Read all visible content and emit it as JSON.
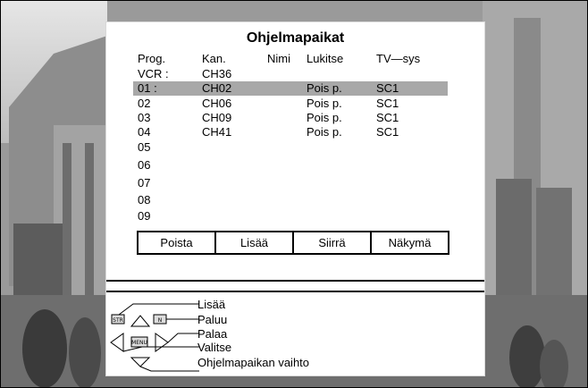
{
  "menu": {
    "title": "Ohjelmapaikat",
    "headers": {
      "prog": "Prog.",
      "kan": "Kan.",
      "nimi": "Nimi",
      "lukitse": "Lukitse",
      "tvsys": "TV—sys"
    },
    "rows": [
      {
        "prog": "VCR :",
        "kan": "CH36",
        "lukitse": "",
        "tvsys": ""
      },
      {
        "prog": "01 :",
        "kan": "CH02",
        "lukitse": "Pois p.",
        "tvsys": "SC1"
      },
      {
        "prog": "02",
        "kan": "CH06",
        "lukitse": "Pois p.",
        "tvsys": "SC1"
      },
      {
        "prog": "03",
        "kan": "CH09",
        "lukitse": "Pois p.",
        "tvsys": "SC1"
      },
      {
        "prog": "04",
        "kan": "CH41",
        "lukitse": "Pois p.",
        "tvsys": "SC1"
      },
      {
        "prog": "05",
        "kan": "",
        "lukitse": "",
        "tvsys": ""
      },
      {
        "prog": "06",
        "kan": "",
        "lukitse": "",
        "tvsys": ""
      },
      {
        "prog": "07",
        "kan": "",
        "lukitse": "",
        "tvsys": ""
      },
      {
        "prog": "08",
        "kan": "",
        "lukitse": "",
        "tvsys": ""
      },
      {
        "prog": "09",
        "kan": "",
        "lukitse": "",
        "tvsys": ""
      }
    ],
    "buttons": [
      "Poista",
      "Lisää",
      "Siirrä",
      "Näkymä"
    ]
  },
  "help": {
    "lisaa": "Lisää",
    "paluu": "Paluu",
    "palaa": "Palaa",
    "valitse": "Valitse",
    "vaihto": "Ohjelmapaikan vaihto",
    "key_str": "STR",
    "key_n": "N",
    "key_menu": "MENU"
  },
  "colors": {
    "highlight": "#a8a8a8",
    "panel": "#ffffff"
  }
}
